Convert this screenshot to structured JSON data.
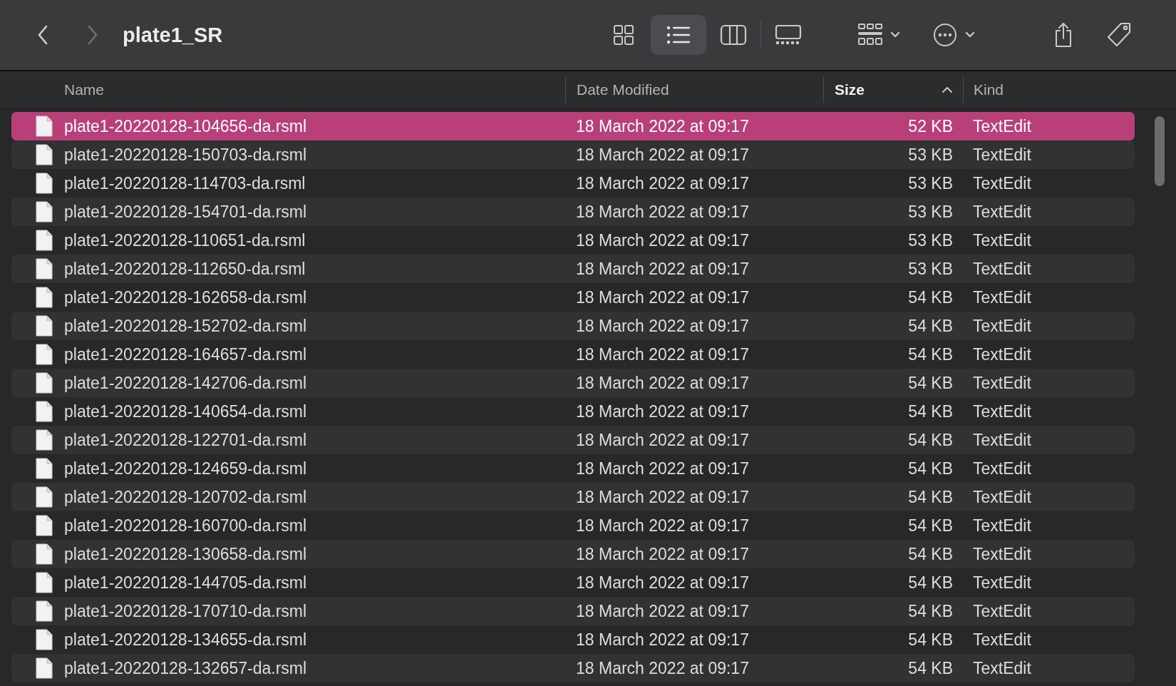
{
  "toolbar": {
    "title": "plate1_SR",
    "back_disabled": false,
    "forward_disabled": true,
    "views": [
      {
        "kind": "icons",
        "selected": false
      },
      {
        "kind": "list",
        "selected": true
      },
      {
        "kind": "columns",
        "selected": false
      },
      {
        "kind": "gallery",
        "selected": false
      }
    ]
  },
  "table": {
    "columns": [
      {
        "label": "Name",
        "selected": false
      },
      {
        "label": "Date Modified",
        "selected": false
      },
      {
        "label": "Size",
        "selected": true
      },
      {
        "label": "Kind",
        "selected": false
      }
    ],
    "rows": [
      {
        "name": "plate1-20220128-104656-da.rsml",
        "date": "18 March 2022 at 09:17",
        "size": "52 KB",
        "kind": "TextEdit",
        "selected": true
      },
      {
        "name": "plate1-20220128-150703-da.rsml",
        "date": "18 March 2022 at 09:17",
        "size": "53 KB",
        "kind": "TextEdit",
        "selected": false
      },
      {
        "name": "plate1-20220128-114703-da.rsml",
        "date": "18 March 2022 at 09:17",
        "size": "53 KB",
        "kind": "TextEdit",
        "selected": false
      },
      {
        "name": "plate1-20220128-154701-da.rsml",
        "date": "18 March 2022 at 09:17",
        "size": "53 KB",
        "kind": "TextEdit",
        "selected": false
      },
      {
        "name": "plate1-20220128-110651-da.rsml",
        "date": "18 March 2022 at 09:17",
        "size": "53 KB",
        "kind": "TextEdit",
        "selected": false
      },
      {
        "name": "plate1-20220128-112650-da.rsml",
        "date": "18 March 2022 at 09:17",
        "size": "53 KB",
        "kind": "TextEdit",
        "selected": false
      },
      {
        "name": "plate1-20220128-162658-da.rsml",
        "date": "18 March 2022 at 09:17",
        "size": "54 KB",
        "kind": "TextEdit",
        "selected": false
      },
      {
        "name": "plate1-20220128-152702-da.rsml",
        "date": "18 March 2022 at 09:17",
        "size": "54 KB",
        "kind": "TextEdit",
        "selected": false
      },
      {
        "name": "plate1-20220128-164657-da.rsml",
        "date": "18 March 2022 at 09:17",
        "size": "54 KB",
        "kind": "TextEdit",
        "selected": false
      },
      {
        "name": "plate1-20220128-142706-da.rsml",
        "date": "18 March 2022 at 09:17",
        "size": "54 KB",
        "kind": "TextEdit",
        "selected": false
      },
      {
        "name": "plate1-20220128-140654-da.rsml",
        "date": "18 March 2022 at 09:17",
        "size": "54 KB",
        "kind": "TextEdit",
        "selected": false
      },
      {
        "name": "plate1-20220128-122701-da.rsml",
        "date": "18 March 2022 at 09:17",
        "size": "54 KB",
        "kind": "TextEdit",
        "selected": false
      },
      {
        "name": "plate1-20220128-124659-da.rsml",
        "date": "18 March 2022 at 09:17",
        "size": "54 KB",
        "kind": "TextEdit",
        "selected": false
      },
      {
        "name": "plate1-20220128-120702-da.rsml",
        "date": "18 March 2022 at 09:17",
        "size": "54 KB",
        "kind": "TextEdit",
        "selected": false
      },
      {
        "name": "plate1-20220128-160700-da.rsml",
        "date": "18 March 2022 at 09:17",
        "size": "54 KB",
        "kind": "TextEdit",
        "selected": false
      },
      {
        "name": "plate1-20220128-130658-da.rsml",
        "date": "18 March 2022 at 09:17",
        "size": "54 KB",
        "kind": "TextEdit",
        "selected": false
      },
      {
        "name": "plate1-20220128-144705-da.rsml",
        "date": "18 March 2022 at 09:17",
        "size": "54 KB",
        "kind": "TextEdit",
        "selected": false
      },
      {
        "name": "plate1-20220128-170710-da.rsml",
        "date": "18 March 2022 at 09:17",
        "size": "54 KB",
        "kind": "TextEdit",
        "selected": false
      },
      {
        "name": "plate1-20220128-134655-da.rsml",
        "date": "18 March 2022 at 09:17",
        "size": "54 KB",
        "kind": "TextEdit",
        "selected": false
      },
      {
        "name": "plate1-20220128-132657-da.rsml",
        "date": "18 March 2022 at 09:17",
        "size": "54 KB",
        "kind": "TextEdit",
        "selected": false
      }
    ]
  }
}
